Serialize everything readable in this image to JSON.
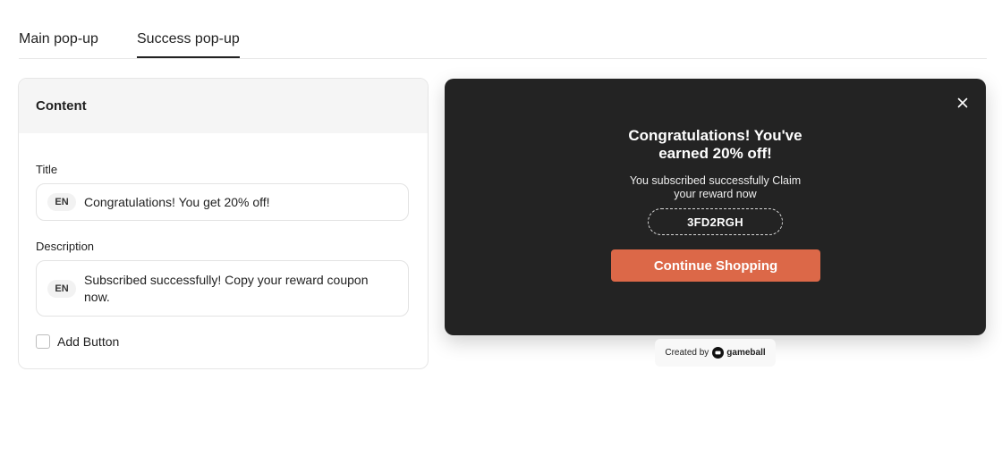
{
  "tabs": [
    {
      "label": "Main pop-up",
      "active": false
    },
    {
      "label": "Success pop-up",
      "active": true
    }
  ],
  "content_panel": {
    "header": "Content",
    "title_field": {
      "label": "Title",
      "lang": "EN",
      "value": "Congratulations! You get 20% off!"
    },
    "description_field": {
      "label": "Description",
      "lang": "EN",
      "value": "Subscribed successfully! Copy your reward coupon now."
    },
    "add_button": {
      "label": "Add Button",
      "checked": false
    }
  },
  "preview": {
    "title_line1": "Congratulations! You've",
    "title_line2": "earned 20% off!",
    "desc_line1": "You subscribed successfully Claim",
    "desc_line2": "your reward now",
    "coupon_code": "3FD2RGH",
    "cta_label": "Continue Shopping",
    "close_icon": "close-icon",
    "accent": "#dc6848",
    "background": "#232323"
  },
  "credit": {
    "prefix": "Created by",
    "brand": "gameball"
  }
}
